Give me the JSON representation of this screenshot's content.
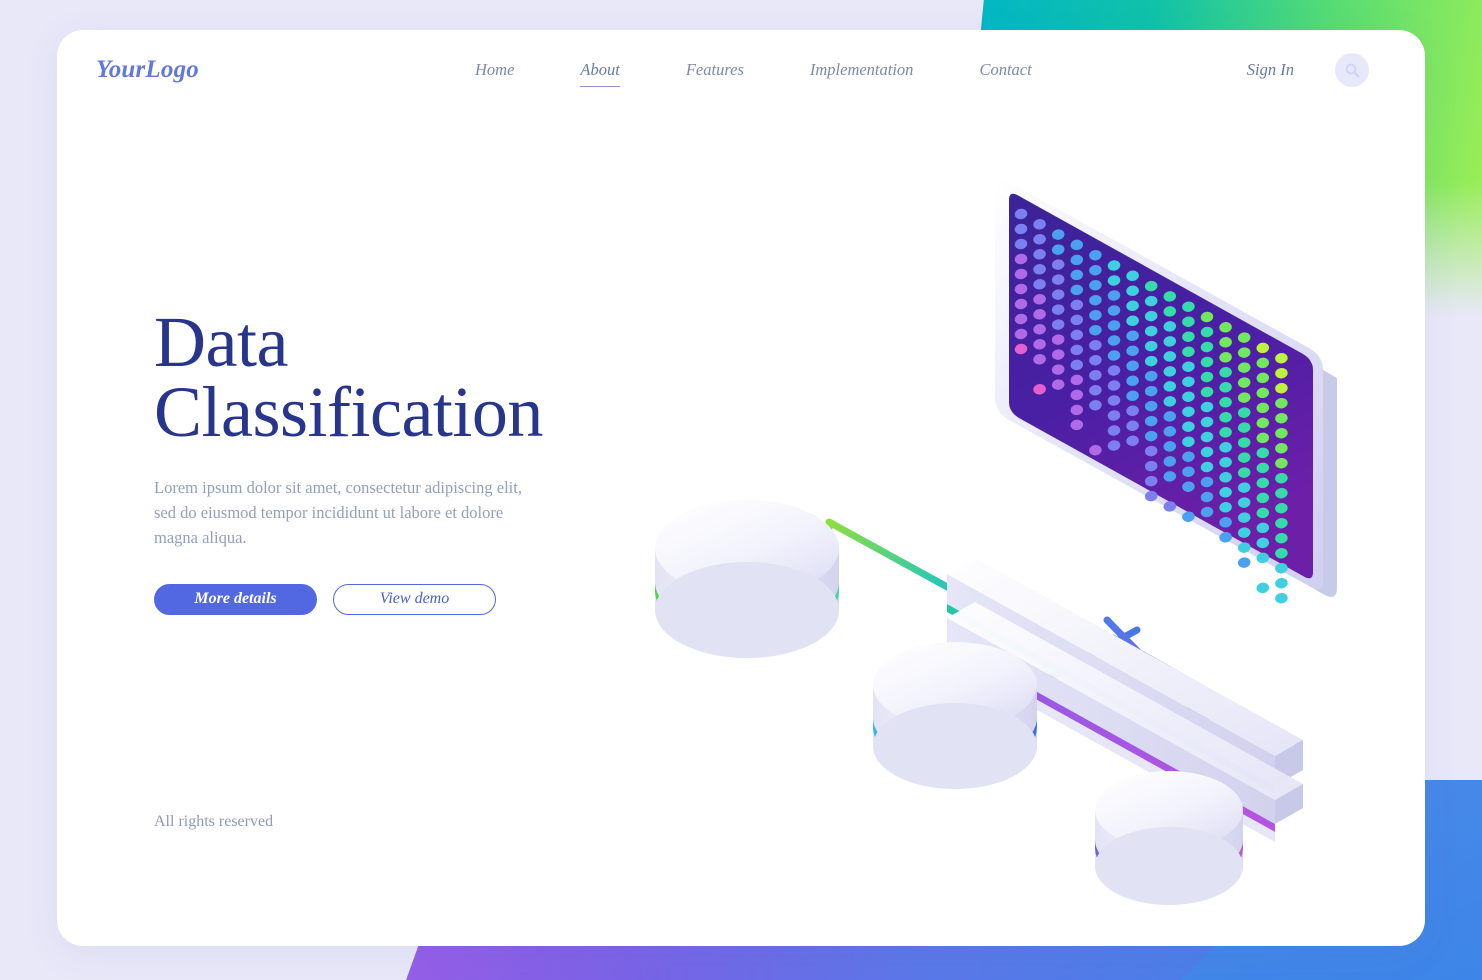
{
  "page": {
    "background_color": "#e8e8f9",
    "card_color": "#ffffff",
    "accent_color": "#5268e3"
  },
  "header": {
    "logo": "YourLogo",
    "nav": [
      {
        "label": "Home",
        "active": false
      },
      {
        "label": "About",
        "active": true
      },
      {
        "label": "Features",
        "active": false
      },
      {
        "label": "Implementation",
        "active": false
      },
      {
        "label": "Contact",
        "active": false
      }
    ],
    "signin_label": "Sign In",
    "search_icon": "search-icon"
  },
  "hero": {
    "title_line1": "Data",
    "title_line2": "Classification",
    "paragraph": "Lorem ipsum dolor sit amet, consectetur adipiscing elit, sed do eiusmod tempor incididunt ut labore et dolore magna aliqua.",
    "primary_button": "More details",
    "secondary_button": "View demo"
  },
  "footer": {
    "rights": "All rights reserved"
  },
  "illustration": {
    "name": "isometric-data-classification-diagram",
    "monitor": {
      "screen_color_top": "#3b2594",
      "screen_color_bottom": "#6a1fa8",
      "frame_color": "#dcdcf5",
      "base_accent_top": "#25c49a",
      "base_accent_bottom": "#9a55e0"
    },
    "databases": [
      {
        "name": "database-cylinder-green",
        "accent": "#62d94a"
      },
      {
        "name": "database-cylinder-blue",
        "accent": "#3d8ee8"
      },
      {
        "name": "database-cylinder-purple",
        "accent": "#9a55e0"
      }
    ],
    "connectors": [
      {
        "name": "connector-green-to-monitor",
        "from": "#8ede3f",
        "to": "#35b7d6"
      },
      {
        "name": "connector-blue-to-monitor",
        "from": "#2f95e0",
        "to": "#4d6fe6"
      },
      {
        "name": "connector-purple-to-monitor",
        "from": "#5b6ee8",
        "to": "#b355e0"
      }
    ],
    "dot_palette": [
      "#ff5fa2",
      "#e45fd0",
      "#b06ae8",
      "#7b7ff0",
      "#4d9ff0",
      "#3fd0e0",
      "#35dba8",
      "#72e85f",
      "#bff23d"
    ]
  },
  "decor": {
    "top_right_gradient": [
      "#00b5c9",
      "#56dc74",
      "#a3f053"
    ],
    "bottom_gradient": [
      "#c163e8",
      "#7b63e6",
      "#3d85e8"
    ]
  }
}
